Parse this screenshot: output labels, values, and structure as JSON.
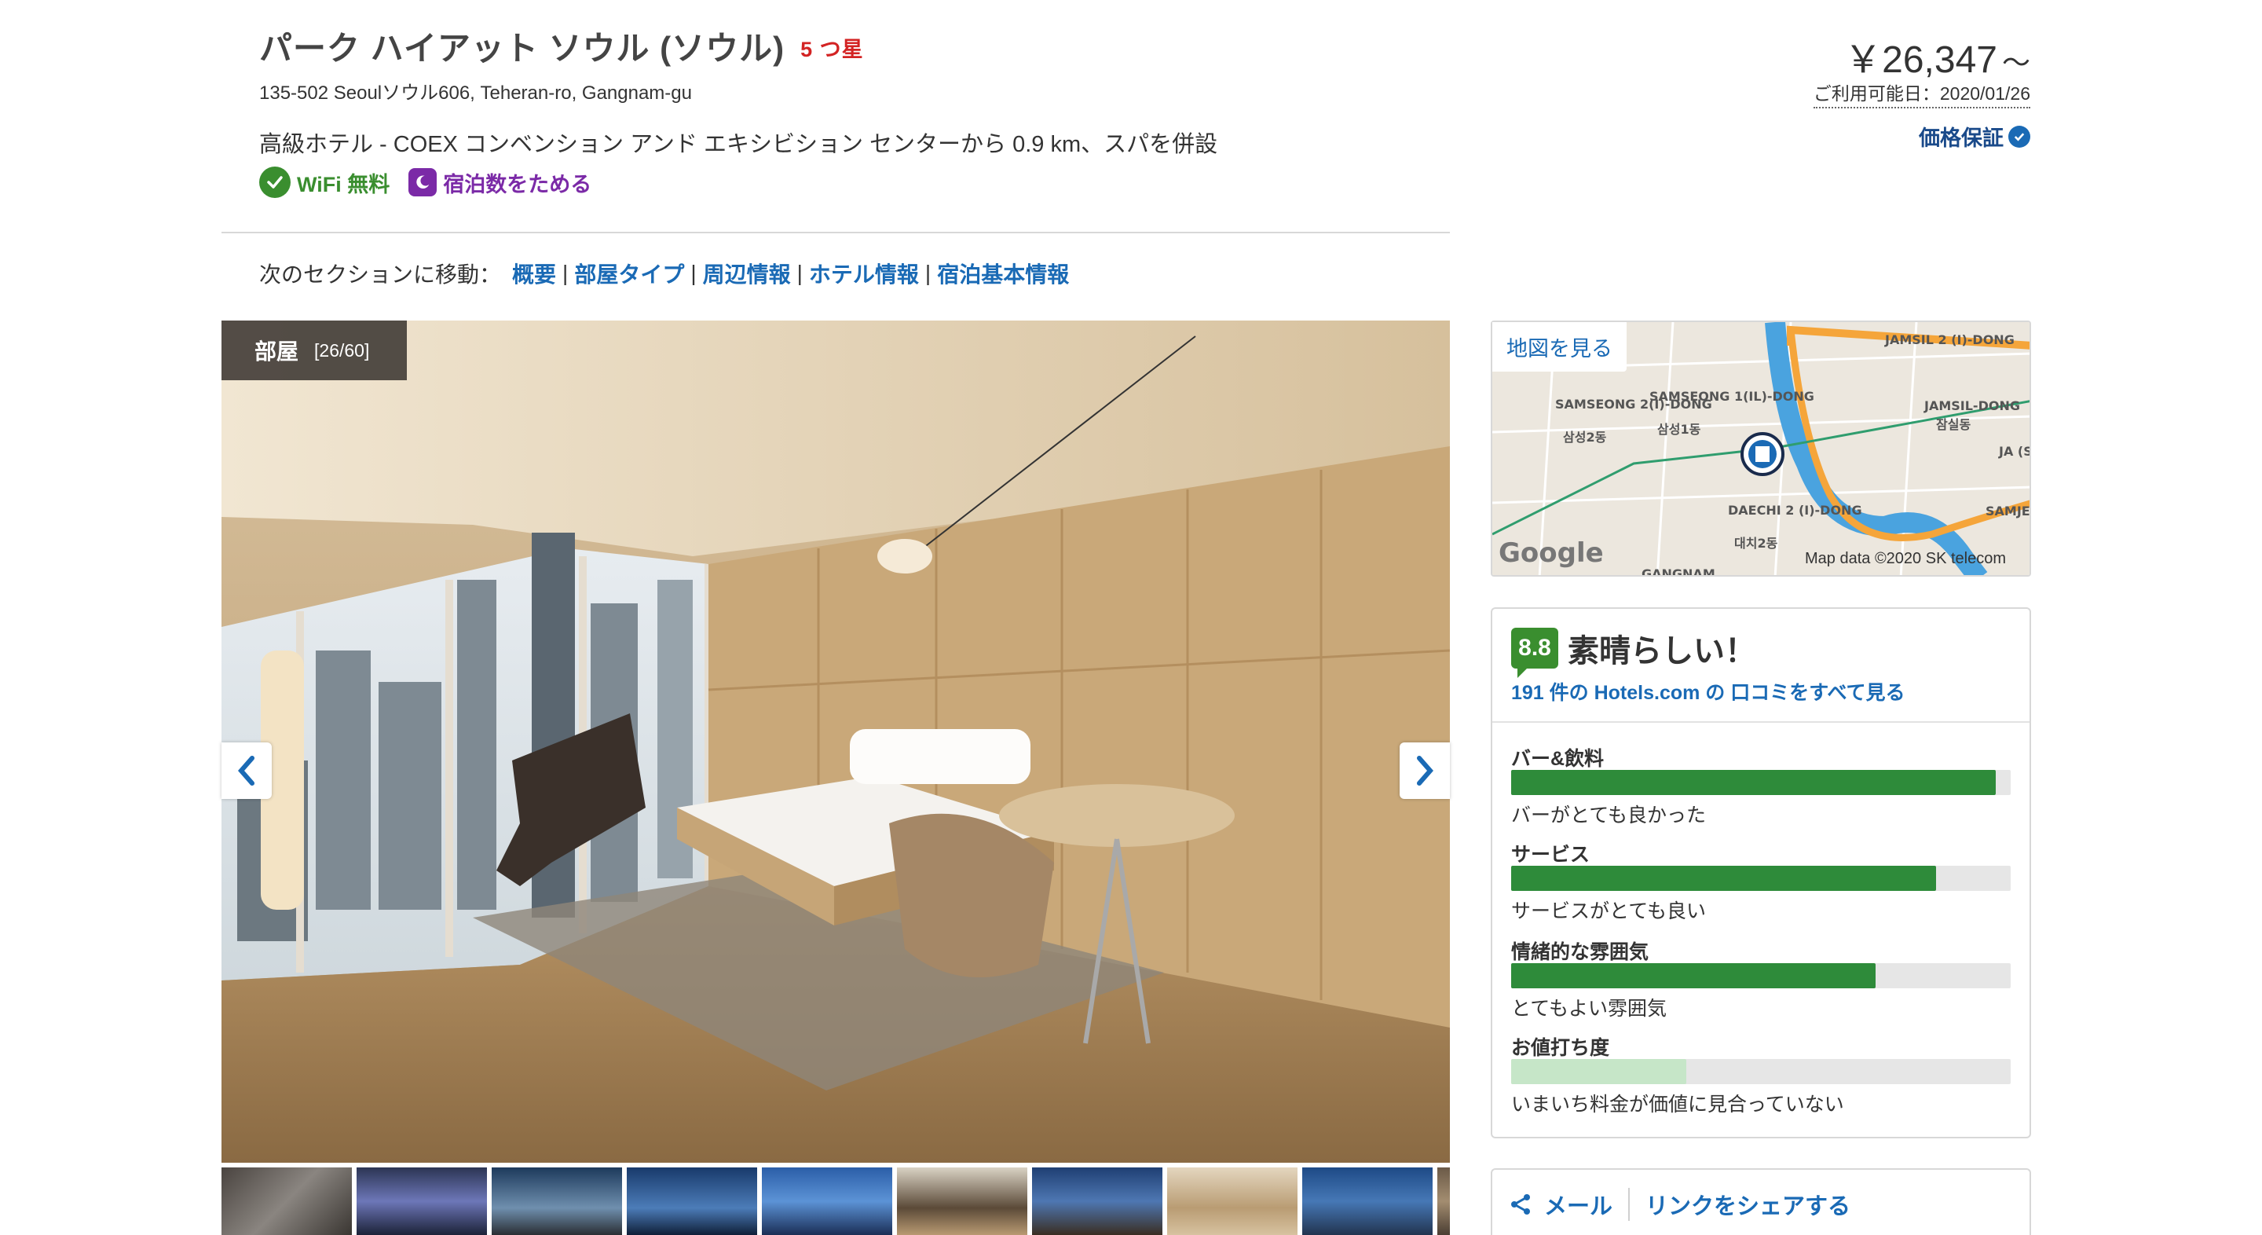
{
  "hotel": {
    "name": "パーク ハイアット ソウル (ソウル)",
    "stars": "5 つ星",
    "address": "135-502 Seoulソウル606, Teheran-ro, Gangnam-gu",
    "description": "高級ホテル - COEX コンベンション アンド エキシビション センターから 0.9 km、スパを併設",
    "tags": {
      "wifi": "WiFi 無料",
      "stay": "宿泊数をためる"
    }
  },
  "price": {
    "amount": "￥26,347",
    "suffix": "～",
    "available": "ご利用可能日：2020/01/26",
    "guarantee": "価格保証"
  },
  "section_nav": {
    "label": "次のセクションに移動：",
    "links": [
      "概要",
      "部屋タイプ",
      "周辺情報",
      "ホテル情報",
      "宿泊基本情報"
    ]
  },
  "gallery": {
    "badge_label": "部屋",
    "badge_counter": "[26/60]",
    "icons": {
      "prev": "chevron-left-icon",
      "next": "chevron-right-icon"
    }
  },
  "map": {
    "link": "地図を見る",
    "attribution": "Map data ©2020 SK telecom",
    "logo": "Google",
    "labels": [
      "JAMSIL 2 (I)-DONG",
      "JAMSIL-DONG",
      "잠실동",
      "SAMSEONG 2(I)-DONG",
      "삼성2동",
      "SAMSEONG 1(IL)-DONG",
      "삼성1동",
      "DAECHI 2 (I)-DONG",
      "대치2동",
      "JA (SAM",
      "SAMJEO",
      "GANGNAM"
    ]
  },
  "reviews": {
    "score": "8.8",
    "rating": "素晴らしい！",
    "link": "191 件の Hotels.com の 口コミをすべて見る",
    "categories": [
      {
        "label": "バー&飲料",
        "fill": 0.97,
        "desc": "バーがとても良かった",
        "color": "#2e8b3a"
      },
      {
        "label": "サービス",
        "fill": 0.85,
        "desc": "サービスがとても良い",
        "color": "#2e8b3a"
      },
      {
        "label": "情緒的な雰囲気",
        "fill": 0.73,
        "desc": "とてもよい雰囲気",
        "color": "#2e8b3a"
      },
      {
        "label": "お値打ち度",
        "fill": 0.35,
        "desc": "いまいち料金が価値に見合っていない",
        "color": "#c6e6c8"
      }
    ]
  },
  "share": {
    "mail": "メール",
    "link": "リンクをシェアする"
  }
}
